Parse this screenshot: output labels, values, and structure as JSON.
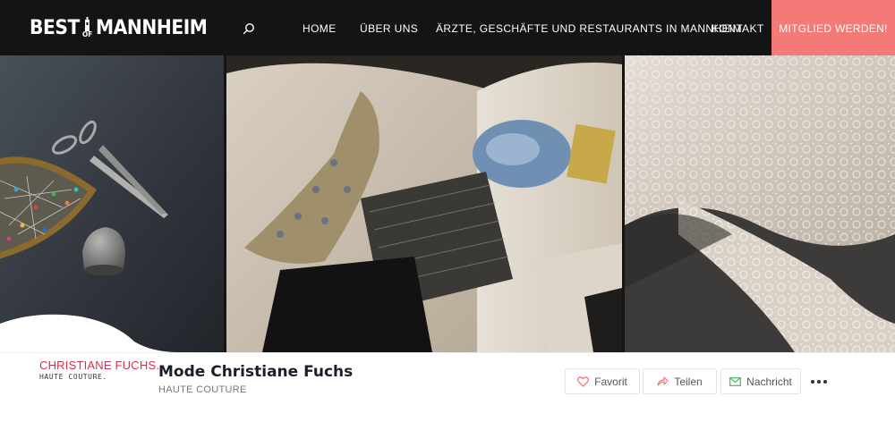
{
  "header": {
    "logo": {
      "word_left": "BEST",
      "word_mid": "OF",
      "word_right": "MANNHEIM"
    },
    "search_icon": "search-icon",
    "nav": [
      {
        "label": "HOME"
      },
      {
        "label": "ÜBER UNS"
      },
      {
        "label": "ÄRZTE, GESCHÄFTE UND RESTAURANTS IN MANNHEIM"
      },
      {
        "label": "KONTAKT"
      }
    ],
    "cta_label": "MITGLIED WERDEN!"
  },
  "gallery": {
    "photos": [
      {
        "subject": "scissors-pins-thimble"
      },
      {
        "subject": "sketchbook-fabric-swatches"
      },
      {
        "subject": "lace-fabric"
      }
    ]
  },
  "profile": {
    "brand_logo": {
      "name": "CHRISTIANE FUCHS.",
      "sub": "HAUTE COUTURE."
    },
    "title": "Mode Christiane Fuchs",
    "category": "HAUTE COUTURE",
    "actions": [
      {
        "label": "Favorit",
        "icon": "heart-icon"
      },
      {
        "label": "Teilen",
        "icon": "share-icon"
      },
      {
        "label": "Nachricht",
        "icon": "mail-icon"
      }
    ],
    "more_icon": "more-icon"
  },
  "colors": {
    "header_bg": "#141414",
    "accent": "#f47a77",
    "brand_red": "#d2334a"
  }
}
